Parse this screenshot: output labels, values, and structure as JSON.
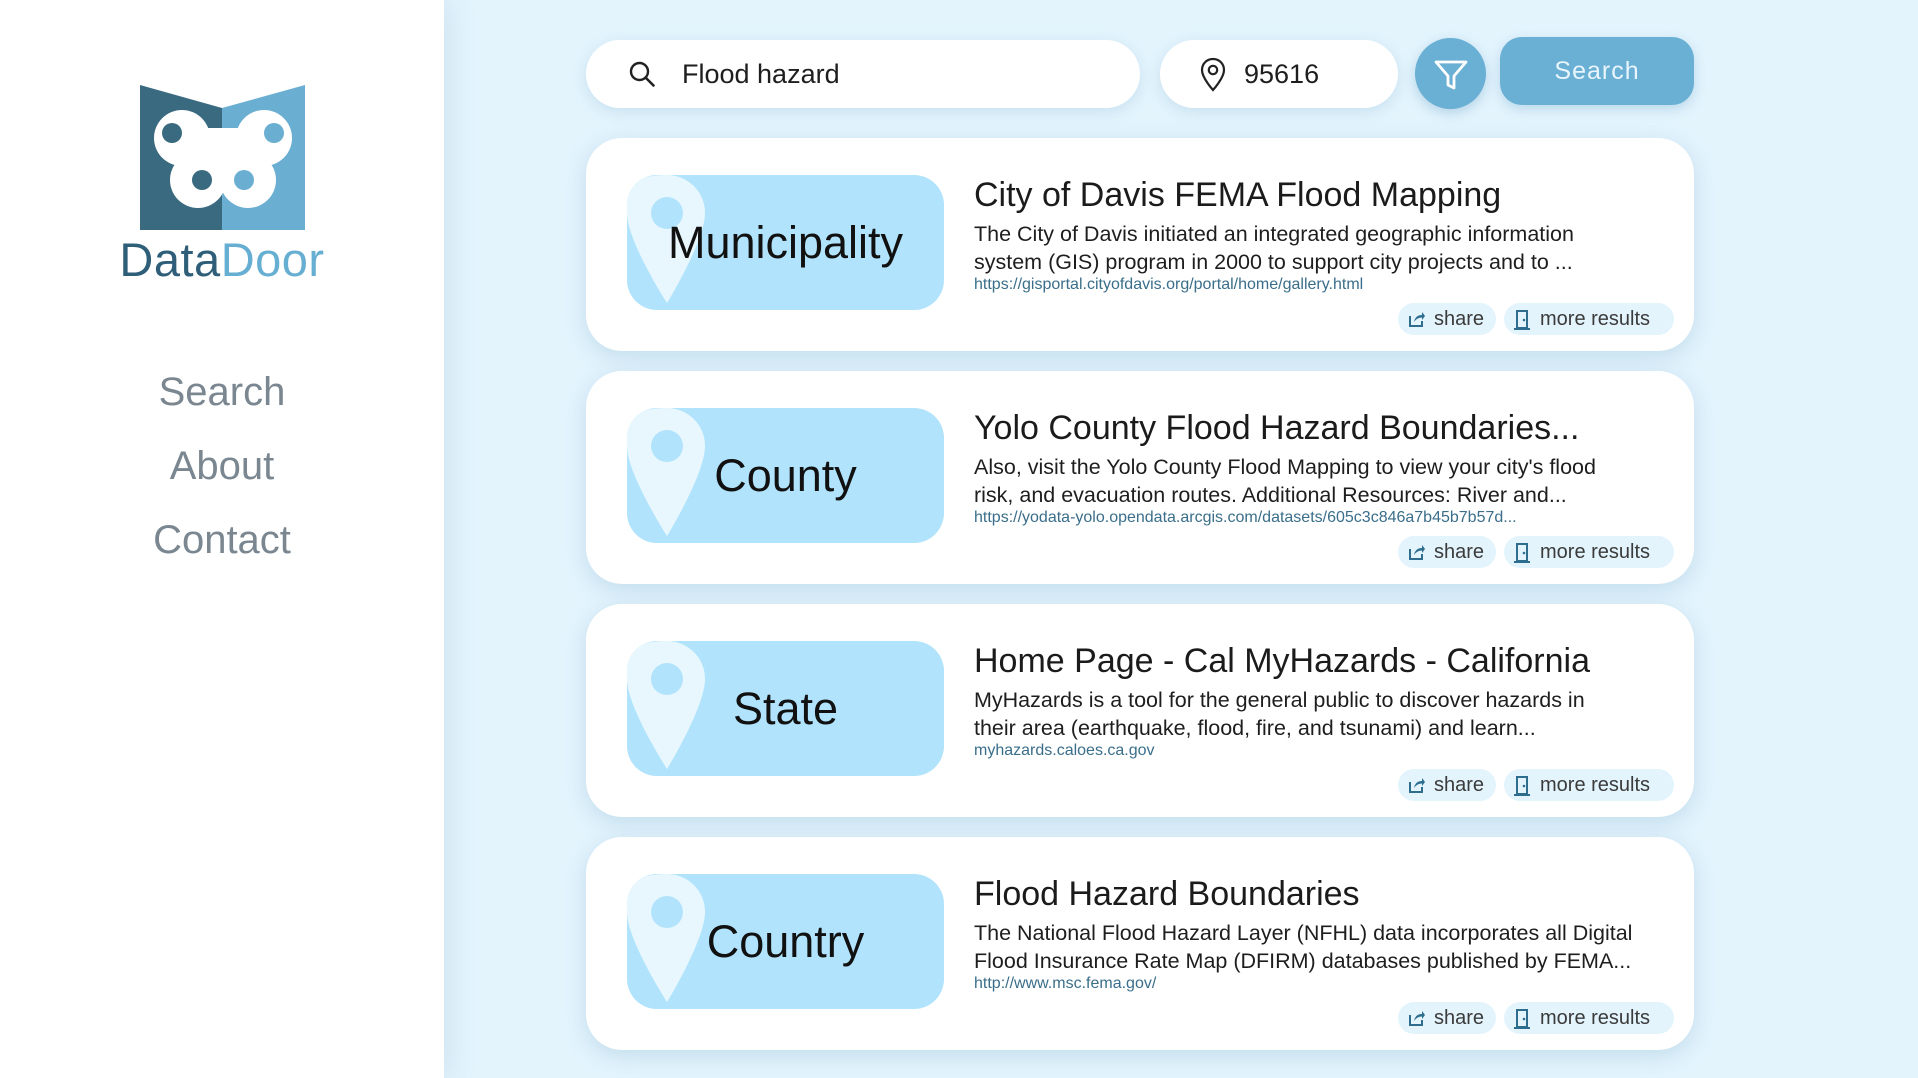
{
  "brand": {
    "name_part1": "Data",
    "name_part2": "Door",
    "logo_dark": "#2f5f78",
    "logo_light": "#66aed2"
  },
  "nav": [
    {
      "label": "Search"
    },
    {
      "label": "About"
    },
    {
      "label": "Contact"
    }
  ],
  "search": {
    "query": "Flood hazard",
    "zip": "95616",
    "button_label": "Search",
    "icon": "search-icon",
    "location_icon": "location-pin-icon",
    "filter_icon": "filter-icon"
  },
  "colors": {
    "accent": "#6aafd4",
    "tag_bg": "#b1e4fc",
    "page_bg": "#e3f4fd"
  },
  "results": [
    {
      "level": "Municipality",
      "title": "City of Davis FEMA Flood Mapping",
      "desc1": "The City of Davis initiated an integrated geographic information",
      "desc2": "system (GIS) program in 2000 to support city projects and to ...",
      "url": "https://gisportal.cityofdavis.org/portal/home/gallery.html",
      "share": "share",
      "more": "more results"
    },
    {
      "level": "County",
      "title": "Yolo County Flood Hazard Boundaries...",
      "desc1": "Also, visit the Yolo County Flood Mapping to view your city's flood",
      "desc2": "risk, and evacuation routes. Additional Resources: River and...",
      "url": "https://yodata-yolo.opendata.arcgis.com/datasets/605c3c846a7b45b7b57d...",
      "share": "share",
      "more": "more results"
    },
    {
      "level": "State",
      "title": "Home Page - Cal MyHazards - California",
      "desc1": "MyHazards is a tool for the general public to discover hazards in",
      "desc2": "their area (earthquake, flood, fire, and tsunami) and learn...",
      "url": "myhazards.caloes.ca.gov",
      "share": "share",
      "more": "more results"
    },
    {
      "level": "Country",
      "title": "Flood Hazard Boundaries",
      "desc1": "The National Flood Hazard Layer (NFHL) data incorporates all Digital",
      "desc2": "Flood Insurance Rate Map (DFIRM) databases published by FEMA...",
      "url": "http://www.msc.fema.gov/",
      "share": "share",
      "more": "more results"
    }
  ]
}
